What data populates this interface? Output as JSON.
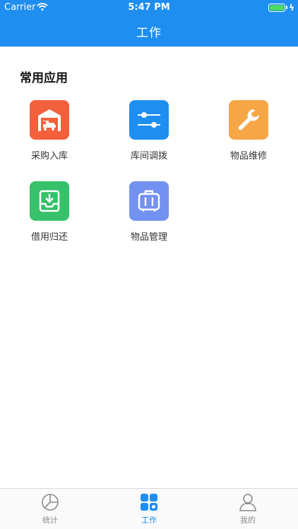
{
  "status_bar": {
    "carrier": "Carrier",
    "time": "5:47 PM"
  },
  "nav": {
    "title": "工作"
  },
  "section": {
    "title": "常用应用"
  },
  "apps": [
    {
      "label": "采购入库",
      "icon": "warehouse-truck-icon",
      "color": "#f2603c"
    },
    {
      "label": "库间调拨",
      "icon": "sliders-icon",
      "color": "#1e8ef0"
    },
    {
      "label": "物品维修",
      "icon": "wrench-icon",
      "color": "#f7a647"
    },
    {
      "label": "借用归还",
      "icon": "inbox-download-icon",
      "color": "#36c16a"
    },
    {
      "label": "物品管理",
      "icon": "suitcase-icon",
      "color": "#7391f0"
    }
  ],
  "tabs": [
    {
      "label": "统计",
      "icon": "pie-chart-icon"
    },
    {
      "label": "工作",
      "icon": "grid-apps-icon",
      "active": true
    },
    {
      "label": "我的",
      "icon": "person-icon"
    }
  ],
  "colors": {
    "primary": "#1e8ef0",
    "tab_inactive": "#8a8a8a"
  }
}
